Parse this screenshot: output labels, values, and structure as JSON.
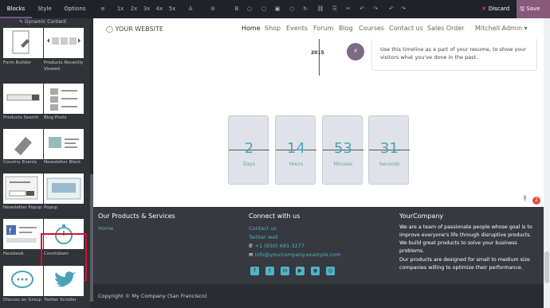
{
  "toolbar": {
    "tabs": [
      "Blocks",
      "Style",
      "Options"
    ],
    "tools": [
      "≡",
      "1x",
      "2x",
      "3x",
      "4x",
      "5x",
      "A",
      "⊘",
      "B",
      "○",
      "○",
      "▣",
      "○",
      "↻",
      "⛓",
      "⎘",
      "✂",
      "↶",
      "↷"
    ],
    "discard": "Discard",
    "save": "Save",
    "accent": "#875a7b"
  },
  "panel": {
    "dynamic_content": "Dynamic Content",
    "snippets": [
      {
        "label": "Form Builder"
      },
      {
        "label": "Products Recently Viewed"
      },
      {
        "label": "Products Search"
      },
      {
        "label": "Blog Posts"
      },
      {
        "label": "Country Events"
      },
      {
        "label": "Newsletter Block"
      },
      {
        "label": "Newsletter Popup"
      },
      {
        "label": "Popup"
      },
      {
        "label": "Facebook"
      },
      {
        "label": "Countdown"
      },
      {
        "label": "Discuss on Group"
      },
      {
        "label": "Twitter Scroller"
      }
    ]
  },
  "site": {
    "logo": "YOUR WEBSITE",
    "nav": [
      "Home",
      "Shop",
      "Events",
      "Forum",
      "Blog",
      "Courses",
      "Contact us",
      "Sales Order",
      "Mitchell Admin ▾"
    ],
    "timeline": {
      "year": "2015",
      "text": "Use this timeline as a part of your resume, to show your visitors what you've done in the past."
    },
    "countdown": [
      {
        "value": "2",
        "unit": "Days"
      },
      {
        "value": "14",
        "unit": "Hours"
      },
      {
        "value": "53",
        "unit": "Minutes"
      },
      {
        "value": "31",
        "unit": "Seconds"
      }
    ],
    "chat_badge": "2"
  },
  "footer": {
    "col1": {
      "title": "Our Products & Services",
      "link": "Home"
    },
    "col2": {
      "title": "Connect with us",
      "links": [
        "Contact us",
        "Twitter wall"
      ],
      "phone": "+1 (650) 691-3277",
      "email": "info@yourcompany.example.com"
    },
    "col3": {
      "title": "YourCompany",
      "p1": "We are a team of passionate people whose goal is to improve everyone's life through disruptive products. We build great products to solve your business problems.",
      "p2": "Our products are designed for small to medium size companies willing to optimize their performance."
    },
    "social_icons": [
      "facebook-icon",
      "twitter-icon",
      "linkedin-icon",
      "youtube-icon",
      "github-icon",
      "instagram-icon"
    ],
    "copyright": "Copyright © My Company (San Francisco)"
  }
}
